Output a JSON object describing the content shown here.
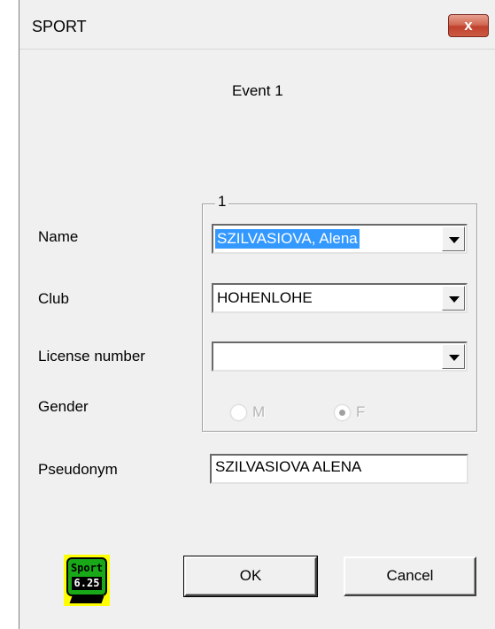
{
  "window": {
    "title": "SPORT",
    "close_label": "x"
  },
  "event_label": "Event 1",
  "group": {
    "label": "1"
  },
  "fields": {
    "name": {
      "label": "Name",
      "value": "SZILVASIOVA, Alena"
    },
    "club": {
      "label": "Club",
      "value": "HOHENLOHE"
    },
    "license": {
      "label": "License number",
      "value": ""
    },
    "gender": {
      "label": "Gender",
      "options": [
        "M",
        "F"
      ],
      "selected": "F"
    },
    "pseudonym": {
      "label": "Pseudonym",
      "value": "SZILVASIOVA ALENA"
    }
  },
  "logo": {
    "line1": "Sport",
    "version": "6.25"
  },
  "buttons": {
    "ok": "OK",
    "cancel": "Cancel"
  },
  "colors": {
    "selection": "#3399ff",
    "close_button": "#c0412c",
    "logo_bg": "#ffff00",
    "logo_green": "#18a818"
  }
}
